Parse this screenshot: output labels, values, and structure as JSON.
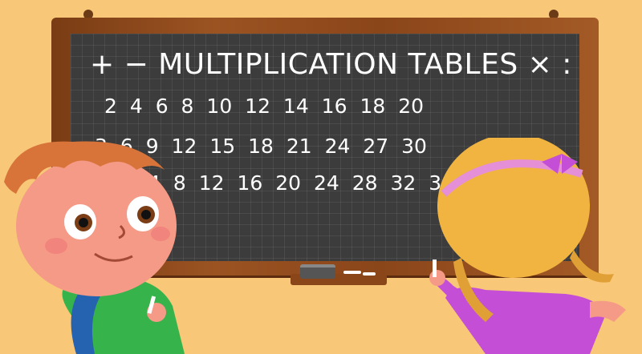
{
  "board": {
    "title": "+ − MULTIPLICATION TABLES × :",
    "row1": "2 4 6 8 10 12 14 16 18 20",
    "row2": "3 6 9 12 15 18 21 24 27 30",
    "row3": "4 8 12 16 20 24 28 32 36 40"
  },
  "colors": {
    "background": "#f8c777",
    "chalkboard": "#3c3c3c",
    "frame": "#8a4519",
    "boy_hair": "#d8743a",
    "girl_hair": "#f2b440",
    "girl_shirt": "#c44fd6",
    "boy_shirt": "#36b34a"
  }
}
